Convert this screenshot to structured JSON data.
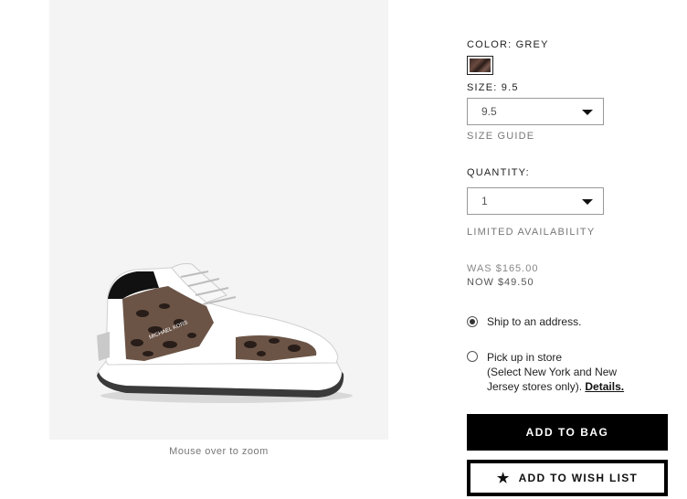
{
  "product_image": {
    "zoom_hint": "Mouse over to zoom",
    "shoe_logo_text": "MICHAEL KORS"
  },
  "options": {
    "color_label": "COLOR: GREY",
    "color_swatch": "leopard-grey",
    "size_label": "SIZE: 9.5",
    "size_value": "9.5",
    "size_guide": "SIZE GUIDE",
    "quantity_label": "QUANTITY:",
    "quantity_value": "1",
    "availability": "LIMITED AVAILABILITY"
  },
  "price": {
    "was": "WAS $165.00",
    "now": "NOW $49.50"
  },
  "fulfillment": {
    "ship_label": "Ship to an address.",
    "ship_selected": true,
    "pickup_line1": "Pick up in store",
    "pickup_line2": "(Select New York and New Jersey stores only).",
    "details_link": "Details."
  },
  "actions": {
    "add_to_bag": "ADD TO BAG",
    "add_to_wish_list": "ADD TO WISH LIST",
    "wish_icon": "star-icon"
  }
}
